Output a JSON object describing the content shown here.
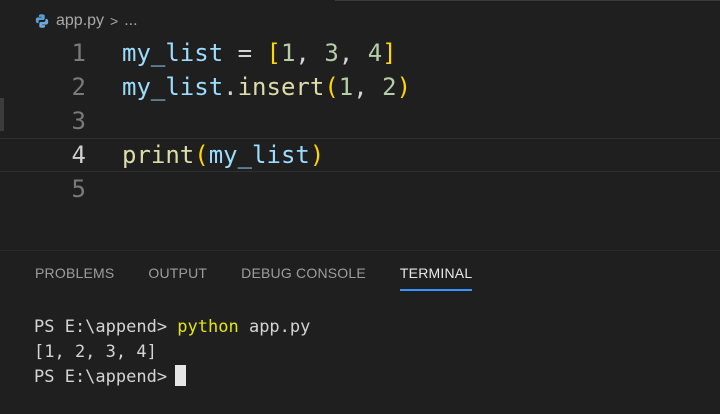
{
  "breadcrumb": {
    "file": "app.py",
    "separator": ">",
    "ellipsis": "..."
  },
  "editor": {
    "lines": [
      {
        "num": "1",
        "parts": [
          "my_list",
          " = ",
          "[",
          "1",
          ", ",
          "3",
          ", ",
          "4",
          "]"
        ]
      },
      {
        "num": "2",
        "parts": [
          "my_list",
          ".",
          "insert",
          "(",
          "1",
          ", ",
          "2",
          ")"
        ]
      },
      {
        "num": "3",
        "parts": []
      },
      {
        "num": "4",
        "parts": [
          "print",
          "(",
          "my_list",
          ")"
        ]
      },
      {
        "num": "5",
        "parts": []
      }
    ],
    "current_line": "4"
  },
  "panel": {
    "tabs": [
      "PROBLEMS",
      "OUTPUT",
      "DEBUG CONSOLE",
      "TERMINAL"
    ],
    "active_tab": "TERMINAL"
  },
  "terminal": {
    "prompt1": "PS E:\\append> ",
    "command": "python",
    "args": " app.py",
    "output": "[1, 2, 3, 4]",
    "prompt2": "PS E:\\append>"
  },
  "colors": {
    "accent": "#3794ff",
    "background": "#1f1f1f",
    "command": "#e5e510",
    "variable": "#9cdcfe",
    "number": "#b5cea8",
    "function": "#dcdcaa",
    "bracket_gold": "#ffd700",
    "bracket_purple": "#da70d6"
  },
  "icons": {
    "file_icon": "python-file-icon",
    "breadcrumb_chevron": "chevron-right-icon"
  }
}
